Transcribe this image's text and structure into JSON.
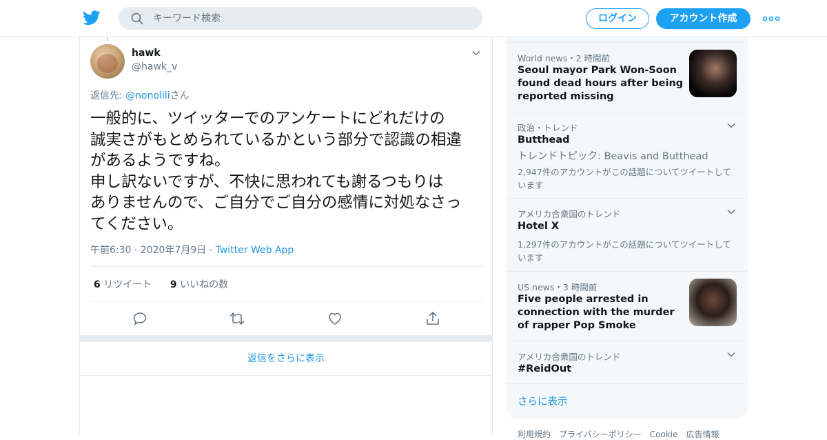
{
  "header": {
    "search_placeholder": "キーワード検索",
    "login_label": "ログイン",
    "signup_label": "アカウント作成"
  },
  "tweet": {
    "name": "hawk",
    "handle": "@hawk_v",
    "reply_prefix": "返信先: ",
    "reply_user": "@nonolili",
    "reply_suffix": "さん",
    "text": "一般的に、ツイッターでのアンケートにどれだけの\n誠実さがもとめられているかという部分で認識の相違\nがあるようですね。\n申し訳ないですが、不快に思われても謝るつもりは\nありませんので、ご自分でご自分の感情に対処なさっ\nてください。",
    "time": "午前6:30",
    "date": "2020年7月9日",
    "source": "Twitter Web App",
    "retweet_count": "6",
    "retweet_label": "リツイート",
    "like_count": "9",
    "like_label": "いいねの数",
    "show_more_replies": "返信をさらに表示"
  },
  "trends": {
    "items": [
      {
        "context": "World news・2 時間前",
        "title": "Seoul mayor Park Won-Soon found dead hours after being reported missing"
      },
      {
        "context": "政治・トレンド",
        "title": "Butthead",
        "subtitle": "トレンドトピック: Beavis and Butthead",
        "count": "2,947件のアカウントがこの話題についてツイートしています"
      },
      {
        "context": "アメリカ合衆国のトレンド",
        "title": "Hotel X",
        "count": "1,297件のアカウントがこの話題についてツイートしています"
      },
      {
        "context": "US news・3 時間前",
        "title": "Five people arrested in connection with the murder of rapper Pop Smoke"
      },
      {
        "context": "アメリカ合衆国のトレンド",
        "title": "#ReidOut"
      }
    ],
    "show_more": "さらに表示"
  },
  "footer": {
    "text": "利用規約　プライバシーポリシー　Cookie　広告情報"
  },
  "colors": {
    "accent": "#1da1f2",
    "link": "#1b95e0",
    "muted": "#657786"
  }
}
